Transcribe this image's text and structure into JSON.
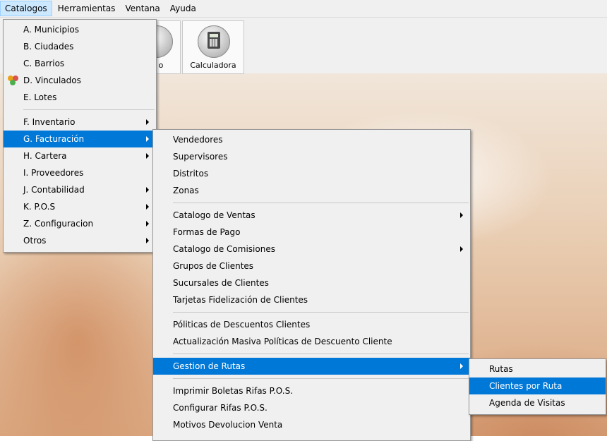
{
  "menubar": {
    "items": [
      "Catalogos",
      "Herramientas",
      "Ventana",
      "Ayuda"
    ]
  },
  "toolbar": {
    "partial_label": "o",
    "calculator_label": "Calculadora"
  },
  "catalogos_menu": {
    "items": [
      {
        "label": "A. Municipios"
      },
      {
        "label": "B. Ciudades"
      },
      {
        "label": "C. Barrios"
      },
      {
        "label": "D. Vinculados",
        "icon": "people-icon"
      },
      {
        "label": "E. Lotes"
      },
      {
        "label": "F.  Inventario"
      },
      {
        "label": "G. Facturación"
      },
      {
        "label": "H. Cartera"
      },
      {
        "label": "I.  Proveedores"
      },
      {
        "label": "J. Contabilidad"
      },
      {
        "label": "K. P.O.S"
      },
      {
        "label": "Z. Configuracion"
      },
      {
        "label": "Otros"
      }
    ]
  },
  "facturacion_menu": {
    "items": [
      {
        "label": "Vendedores"
      },
      {
        "label": "Supervisores"
      },
      {
        "label": "Distritos"
      },
      {
        "label": "Zonas"
      },
      {
        "label": "Catalogo de Ventas"
      },
      {
        "label": "Formas de Pago"
      },
      {
        "label": "Catalogo de Comisiones"
      },
      {
        "label": "Grupos de Clientes"
      },
      {
        "label": "Sucursales de Clientes"
      },
      {
        "label": "Tarjetas Fidelización de Clientes"
      },
      {
        "label": "Póliticas de Descuentos Clientes"
      },
      {
        "label": "Actualización Masiva Políticas de Descuento Cliente"
      },
      {
        "label": "Gestion de  Rutas"
      },
      {
        "label": "Imprimir Boletas Rifas P.O.S."
      },
      {
        "label": "Configurar Rifas  P.O.S."
      },
      {
        "label": "Motivos Devolucion Venta"
      }
    ]
  },
  "rutas_menu": {
    "items": [
      {
        "label": "Rutas"
      },
      {
        "label": "Clientes por Ruta"
      },
      {
        "label": "Agenda de Visitas"
      }
    ]
  },
  "colors": {
    "highlight": "#0078d7",
    "menu_bg": "#f0f0f0",
    "menubar_active": "#cce8ff"
  }
}
